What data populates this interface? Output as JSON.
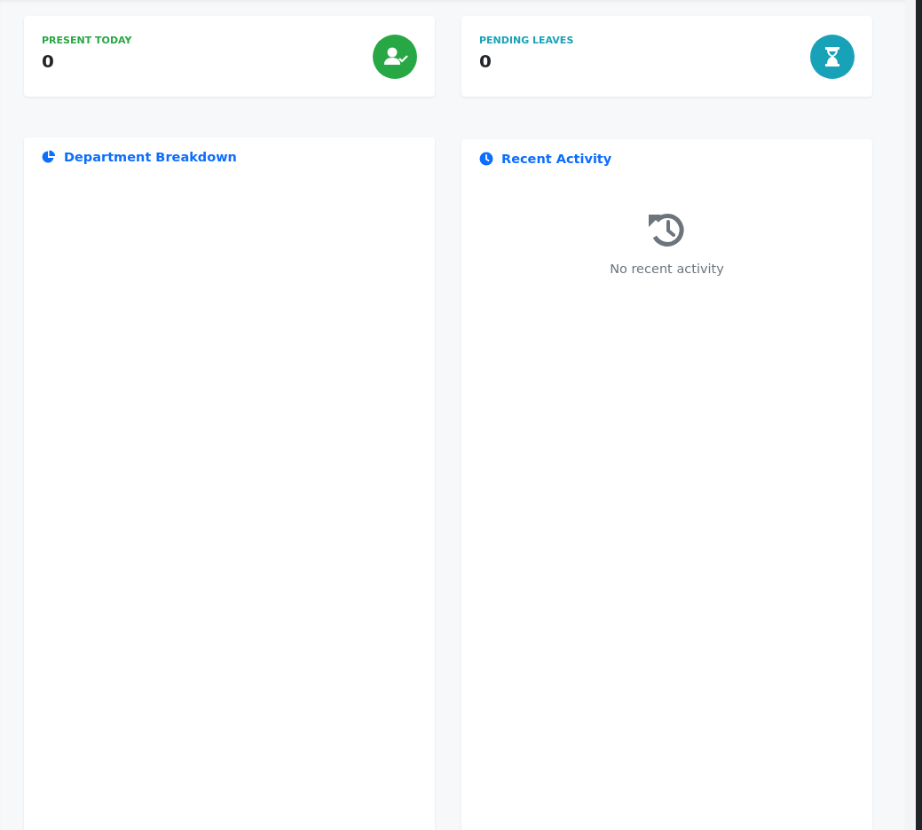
{
  "stats": [
    {
      "label": "PRESENT TODAY",
      "value": "0",
      "color": "#28a745",
      "kind": "user-check"
    },
    {
      "label": "PENDING LEAVES",
      "value": "0",
      "color": "#17a2b8",
      "kind": "hourglass"
    }
  ],
  "panels": [
    {
      "title": "Department Breakdown",
      "kind": "pie"
    },
    {
      "title": "Recent Activity",
      "kind": "clock",
      "empty_message": "No recent activity"
    }
  ]
}
